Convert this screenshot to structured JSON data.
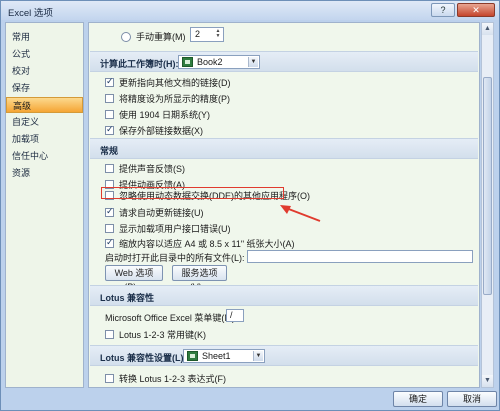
{
  "window": {
    "title": "Excel 选项"
  },
  "sidebar": {
    "items": [
      {
        "label": "常用"
      },
      {
        "label": "公式"
      },
      {
        "label": "校对"
      },
      {
        "label": "保存"
      },
      {
        "label": "高级",
        "active": true
      },
      {
        "label": "自定义"
      },
      {
        "label": "加载项"
      },
      {
        "label": "信任中心"
      },
      {
        "label": "资源"
      }
    ]
  },
  "calc": {
    "manual_label": "手动重算(M)",
    "manual_value": "2"
  },
  "workbook_section": {
    "label": "计算此工作簿时(H):",
    "selected_workbook": "Book2",
    "options": [
      {
        "label": "更新指向其他文档的链接(D)",
        "checked": true
      },
      {
        "label": "将精度设为所显示的精度(P)",
        "checked": false
      },
      {
        "label": "使用 1904 日期系统(Y)",
        "checked": false
      },
      {
        "label": "保存外部链接数据(X)",
        "checked": true
      }
    ]
  },
  "general_section": {
    "label": "常规",
    "options": [
      {
        "label": "提供声音反馈(S)",
        "checked": false
      },
      {
        "label": "提供动画反馈(A)",
        "checked": false
      },
      {
        "label": "忽略使用动态数据交换(DDE)的其他应用程序(O)",
        "checked": false
      },
      {
        "label": "请求自动更新链接(U)",
        "checked": true
      },
      {
        "label": "显示加载项用户接口错误(U)",
        "checked": false
      },
      {
        "label": "缩放内容以适应 A4 或 8.5 x 11\" 纸张大小(A)",
        "checked": true
      }
    ],
    "startup_label": "启动时打开此目录中的所有文件(L):",
    "startup_value": "",
    "web_options_button": "Web 选项(P)...",
    "service_options_button": "服务选项(V)..."
  },
  "lotus_section": {
    "label": "Lotus 兼容性",
    "menu_key_label": "Microsoft Office Excel 菜单键(M):",
    "menu_key_value": "/",
    "nav_keys_label": "Lotus 1-2-3 常用键(K)",
    "nav_keys_checked": false
  },
  "lotus_settings_section": {
    "label": "Lotus 兼容性设置(L):",
    "selected_sheet": "Sheet1",
    "formula_label": "转换 Lotus 1-2-3 表达式(F)",
    "formula_checked": false
  },
  "footer": {
    "ok_label": "确定",
    "cancel_label": "取消"
  },
  "colors": {
    "active_nav": "#f5a534",
    "highlight": "#e03b2e",
    "panel_background": "#f0f7ec"
  }
}
